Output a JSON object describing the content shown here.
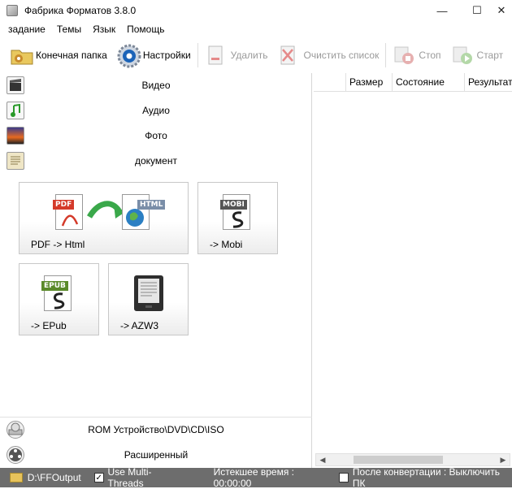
{
  "window": {
    "title": "Фабрика Форматов 3.8.0",
    "minimize": "—",
    "maximize": "☐",
    "close": "✕"
  },
  "menu": [
    "задание",
    "Темы",
    "Язык",
    "Помощь"
  ],
  "toolbar": {
    "output_folder": "Конечная папка",
    "settings": "Настройки",
    "remove": "Удалить",
    "clear_list": "Очистить список",
    "stop": "Стоп",
    "start": "Старт"
  },
  "categories": {
    "video": "Видео",
    "audio": "Аудио",
    "photo": "Фото",
    "document": "документ"
  },
  "tiles": {
    "pdf_html": "PDF -> Html",
    "mobi": "-> Mobi",
    "epub": "-> EPub",
    "azw3": "-> AZW3",
    "pdf_tag": "PDF",
    "html_tag": "HTML",
    "mobi_tag": "MOBI",
    "epub_tag": "EPUB"
  },
  "bottom": {
    "rom": "ROM Устройство\\DVD\\CD\\ISO",
    "advanced": "Расширенный"
  },
  "table": {
    "columns": [
      "",
      "Размер",
      "Состояние",
      "Результат"
    ]
  },
  "status": {
    "output_path": "D:\\FFOutput",
    "multithreads": "Use Multi-Threads",
    "multithreads_checked": true,
    "elapsed": "Истекшее время : 00:00:00",
    "after_convert": "После конвертации : Выключить ПК",
    "after_convert_checked": false
  }
}
